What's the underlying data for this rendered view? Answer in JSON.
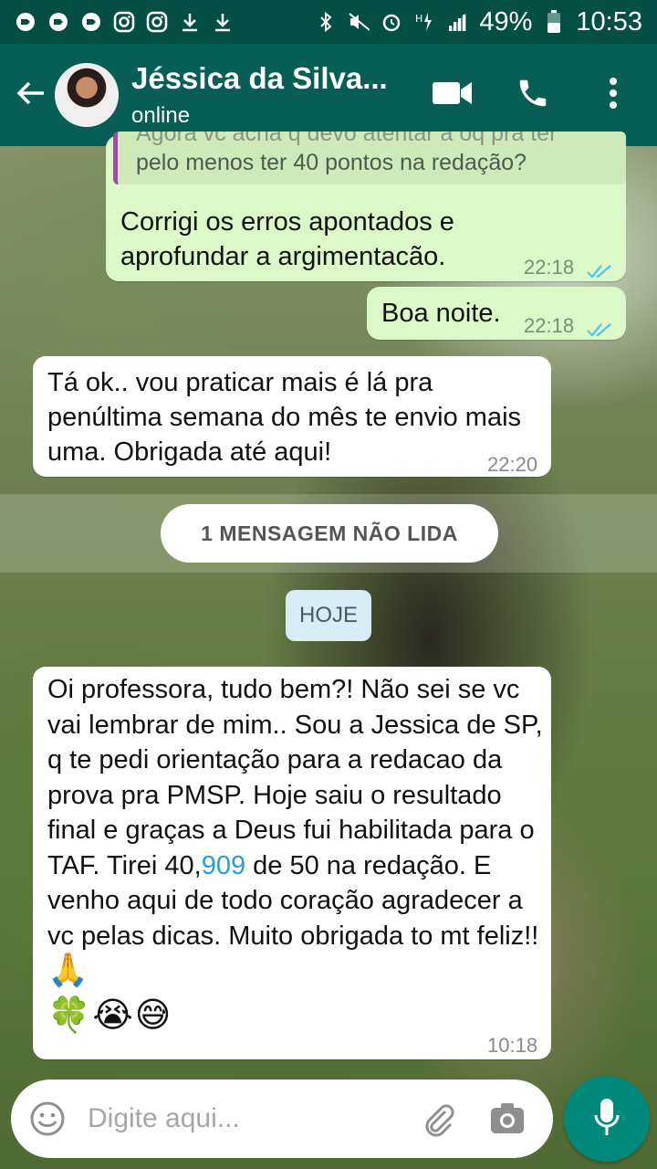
{
  "statusbar": {
    "battery": "49%",
    "time": "10:53",
    "network": "H"
  },
  "header": {
    "contact_name": "Jéssica da Silva...",
    "status": "online"
  },
  "messages": [
    {
      "direction": "out",
      "quoted_text": "pelo menos ter 40 pontos na redação?",
      "quoted_cut_line": "Agora vc acha q devo atentar a oq pra ter",
      "text": "Corrigi os erros apontados e aprofundar a argimentacão.",
      "time": "22:18",
      "read": true
    },
    {
      "direction": "out",
      "text": "Boa noite.",
      "time": "22:18",
      "read": true
    },
    {
      "direction": "in",
      "text": "Tá ok.. vou  praticar mais é lá pra penúltima semana do mês te envio mais uma. Obrigada até aqui!",
      "time": "22:20"
    },
    {
      "direction": "in",
      "text_before_link": "Oi professora, tudo bem?! Não sei se vc vai lembrar de mim.. Sou a Jessica de SP, q te pedi orientação para a redacao da prova pra PMSP. Hoje saiu o resultado final e graças a Deus fui habilitada para o TAF. Tirei 40,",
      "link_text": "909",
      "text_after_link": " de 50 na redação. E venho aqui de todo coração agradecer a vc pelas dicas. Muito obrigada to mt feliz!!",
      "emoji_inline": "🙏",
      "emoji_line": "🍀😭😅",
      "time": "10:18"
    }
  ],
  "unread_banner": "1 MENSAGEM NÃO LIDA",
  "date_chip": "HOJE",
  "composer": {
    "placeholder": "Digite aqui..."
  },
  "colors": {
    "statusbar": "#044e43",
    "appbar": "#075e54",
    "outgoing_bubble": "#dcf8c6",
    "incoming_bubble": "#ffffff",
    "read_ticks": "#4fc3f7",
    "mic_button": "#00897b",
    "link": "#2b9bd6"
  },
  "icons": {
    "header": [
      "back-arrow-icon",
      "video-call-icon",
      "phone-icon",
      "more-vert-icon"
    ],
    "composer": [
      "emoji-icon",
      "attach-icon",
      "camera-icon",
      "mic-icon"
    ]
  }
}
